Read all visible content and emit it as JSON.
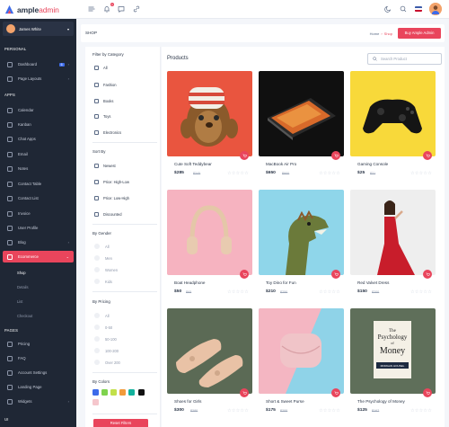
{
  "brand": {
    "name_main": "ample",
    "name_accent": "admin"
  },
  "topbar": {
    "notification_count": "1",
    "language_flag": "gb-flag-icon"
  },
  "user": {
    "name": "James White"
  },
  "sidebar": {
    "sections": {
      "personal": "PERSONAL",
      "apps": "APPS",
      "pages": "PAGES",
      "ui": "UI"
    },
    "personal_items": [
      {
        "label": "Dashboard",
        "count": "6",
        "icon": "dashboard-icon"
      },
      {
        "label": "Page Layouts",
        "icon": "layout-icon"
      }
    ],
    "app_items": [
      {
        "label": "Calendar"
      },
      {
        "label": "Kanban"
      },
      {
        "label": "Chat Apps"
      },
      {
        "label": "Email"
      },
      {
        "label": "Notes"
      },
      {
        "label": "Contact Table"
      },
      {
        "label": "Contact List"
      },
      {
        "label": "Invoice"
      },
      {
        "label": "User Profile"
      },
      {
        "label": "Blog"
      },
      {
        "label": "Ecommerce"
      }
    ],
    "ecommerce_sub": [
      "Shop",
      "Details",
      "List",
      "Checkout"
    ],
    "page_items": [
      {
        "label": "Pricing"
      },
      {
        "label": "FAQ"
      },
      {
        "label": "Account Settings"
      },
      {
        "label": "Landing Page"
      },
      {
        "label": "Widgets"
      }
    ]
  },
  "header": {
    "title": "SHOP",
    "breadcrumb_home": "Home",
    "breadcrumb_current": "Shop",
    "buy_label": "Buy Ample Admin"
  },
  "filters": {
    "category_heading": "Filter by Category",
    "categories": [
      "All",
      "Fashion",
      "Books",
      "Toys",
      "Electronics"
    ],
    "sort_heading": "Sort By",
    "sort_options": [
      "Newest",
      "Price: High-Low",
      "Price: Low-High",
      "Discounted"
    ],
    "gender_heading": "By Gender",
    "genders": [
      "All",
      "Men",
      "Women",
      "Kids"
    ],
    "pricing_heading": "By Pricing",
    "pricing": [
      "All",
      "0-50",
      "50-100",
      "100-200",
      "Over 200"
    ],
    "colors_heading": "By Colors",
    "colors": [
      "#3d6be9",
      "#7fd34e",
      "#c2e04a",
      "#f29b3b",
      "#13b29d",
      "#121212",
      "#f5c6cc"
    ],
    "reset_label": "Reset Filters"
  },
  "products": {
    "title": "Products",
    "search_placeholder": "Search Product",
    "items": [
      {
        "name": "Cute Soft Teddybear",
        "price": "$285",
        "old": "$345"
      },
      {
        "name": "MacBook Air Pro",
        "price": "$650",
        "old": "$900"
      },
      {
        "name": "Gaming Console",
        "price": "$25",
        "old": "$31"
      },
      {
        "name": "Boat Headphone",
        "price": "$50",
        "old": "$65"
      },
      {
        "name": "Toy Dino for Fun",
        "price": "$210",
        "old": "$250"
      },
      {
        "name": "Red Valvet Dress",
        "price": "$150",
        "old": "$200"
      },
      {
        "name": "Shoes for Girls",
        "price": "$300",
        "old": "$380"
      },
      {
        "name": "Short & Sweet Purse",
        "price": "$175",
        "old": "$200"
      },
      {
        "name": "The Psychology of Money",
        "price": "$125",
        "old": "$167"
      }
    ],
    "stars": "☆☆☆☆☆"
  },
  "book_cover": {
    "line1": "The",
    "line2": "Psychology",
    "line3": "of",
    "line4": "Money",
    "author": "MORGAN HOUSEL"
  }
}
